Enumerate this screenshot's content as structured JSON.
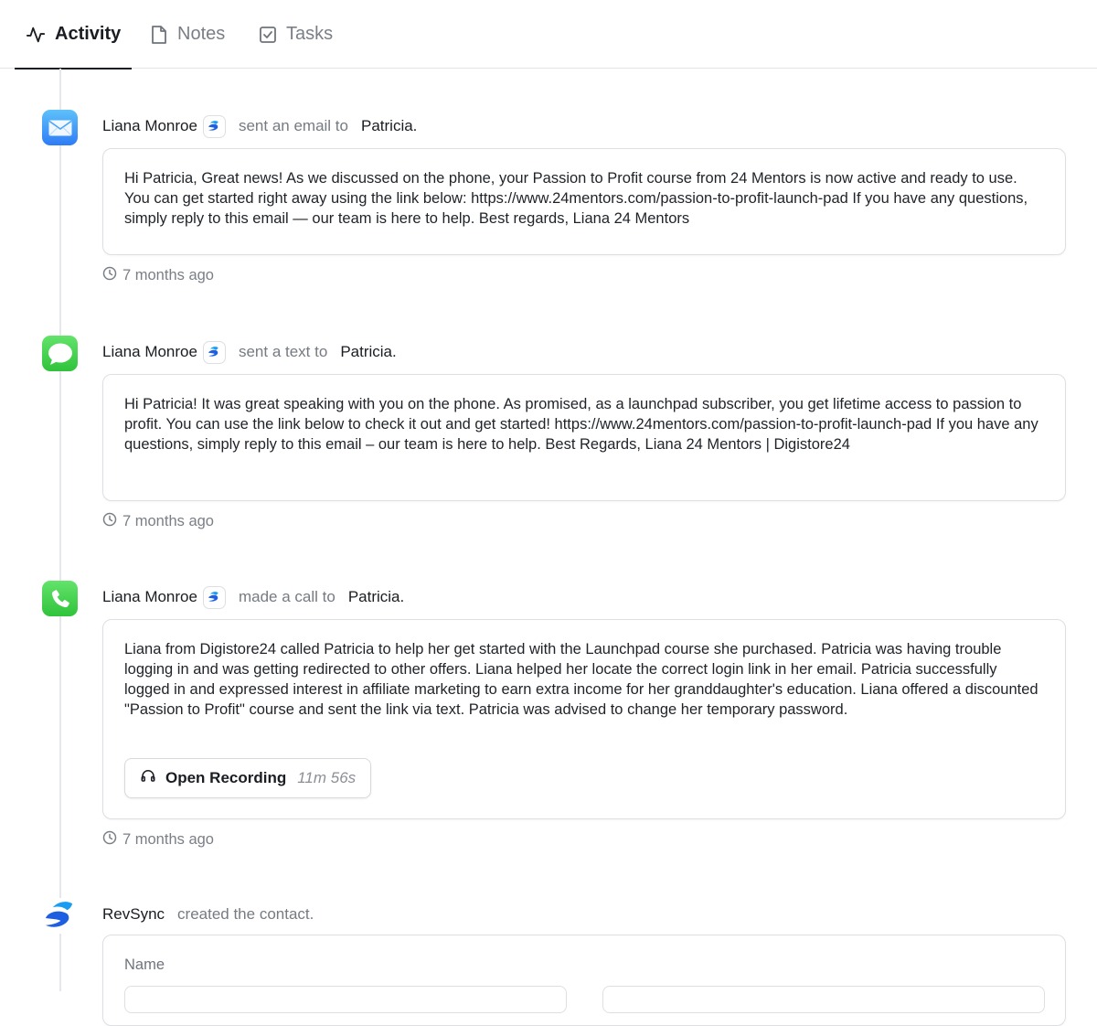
{
  "tabs": [
    {
      "label": "Activity",
      "icon": "activity-icon",
      "active": true
    },
    {
      "label": "Notes",
      "icon": "file-icon",
      "active": false
    },
    {
      "label": "Tasks",
      "icon": "checkbox-icon",
      "active": false
    }
  ],
  "colors": {
    "accent": "#1a1d21",
    "mail": "#2e7cf6",
    "message": "#34c759",
    "call": "#34c759",
    "brand_blue": "#1d6fe5"
  },
  "activities": [
    {
      "type": "email",
      "icon": "mail-icon",
      "actor": "Liana Monroe",
      "verb": "sent an email to",
      "target": "Patricia.",
      "body": "Hi Patricia, Great news! As we discussed on the phone, your Passion to Profit course from 24 Mentors is now active and ready to use. You can get started right away using the link below: https://www.24mentors.com/passion-to-profit-launch-pad If you have any questions, simply reply to this email — our team is here to help. Best regards, Liana 24 Mentors",
      "time": "7 months ago"
    },
    {
      "type": "text",
      "icon": "message-icon",
      "actor": "Liana Monroe",
      "verb": "sent a text to",
      "target": "Patricia.",
      "body": "Hi Patricia! It was great speaking with you on the phone. As promised, as a launchpad subscriber, you get lifetime access to passion to profit. You can use the link below to check it out and get started! https://www.24mentors.com/passion-to-profit-launch-pad If you have any questions, simply reply to this email – our team is here to help. Best Regards, Liana 24 Mentors | Digistore24",
      "time": "7 months ago"
    },
    {
      "type": "call",
      "icon": "phone-icon",
      "actor": "Liana Monroe",
      "verb": "made a call to",
      "target": "Patricia.",
      "body": "Liana from Digistore24 called Patricia to help her get started with the Launchpad course she purchased. Patricia was having trouble logging in and was getting redirected to other offers. Liana helped her locate the correct login link in her email. Patricia successfully logged in and expressed interest in affiliate marketing to earn extra income for her granddaughter's education. Liana offered a discounted \"Passion to Profit\" course and sent the link via text. Patricia was advised to change her temporary password.",
      "recording_label": "Open Recording",
      "recording_duration": "11m 56s",
      "time": "7 months ago"
    },
    {
      "type": "created",
      "icon": "revsync-logo-icon",
      "actor": "RevSync",
      "verb": "created the contact.",
      "field_label": "Name"
    }
  ]
}
